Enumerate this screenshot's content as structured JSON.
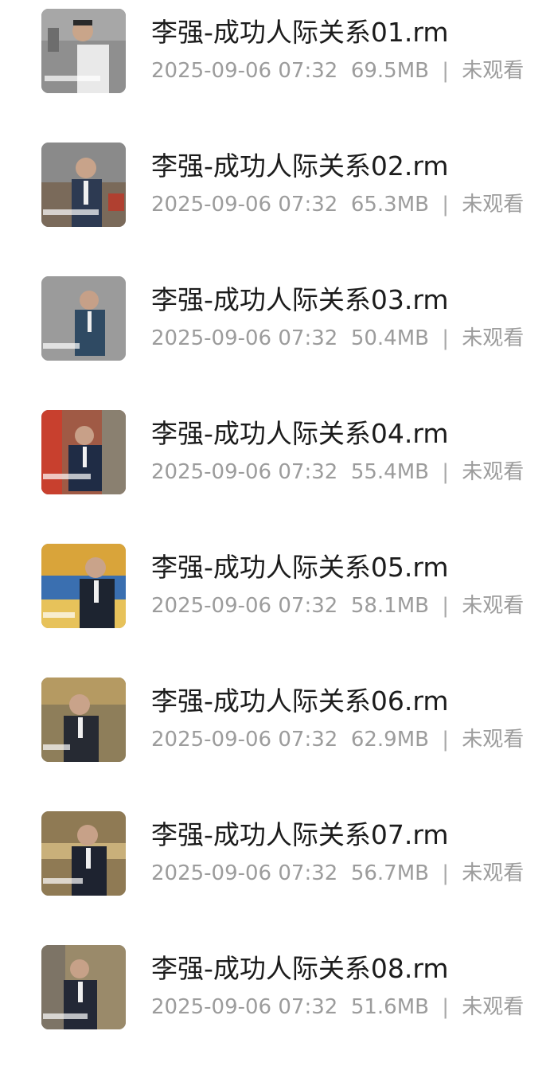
{
  "files": [
    {
      "name": "李强-成功人际关系01.rm",
      "date": "2025-09-06 07:32",
      "size": "69.5MB",
      "status": "未观看",
      "thumb_bg": "#8f8f8f",
      "thumb_accent": "#e9e9e9"
    },
    {
      "name": "李强-成功人际关系02.rm",
      "date": "2025-09-06 07:32",
      "size": "65.3MB",
      "status": "未观看",
      "thumb_bg": "#8a8a8a",
      "thumb_accent": "#2d3a52"
    },
    {
      "name": "李强-成功人际关系03.rm",
      "date": "2025-09-06 07:32",
      "size": "50.4MB",
      "status": "未观看",
      "thumb_bg": "#9b9b9b",
      "thumb_accent": "#2f4a63"
    },
    {
      "name": "李强-成功人际关系04.rm",
      "date": "2025-09-06 07:32",
      "size": "55.4MB",
      "status": "未观看",
      "thumb_bg": "#a05a45",
      "thumb_accent": "#1f2c45"
    },
    {
      "name": "李强-成功人际关系05.rm",
      "date": "2025-09-06 07:32",
      "size": "58.1MB",
      "status": "未观看",
      "thumb_bg": "#d9a43a",
      "thumb_accent": "#1d2430"
    },
    {
      "name": "李强-成功人际关系06.rm",
      "date": "2025-09-06 07:32",
      "size": "62.9MB",
      "status": "未观看",
      "thumb_bg": "#8e7e5a",
      "thumb_accent": "#262a33"
    },
    {
      "name": "李强-成功人际关系07.rm",
      "date": "2025-09-06 07:32",
      "size": "56.7MB",
      "status": "未观看",
      "thumb_bg": "#8f7a54",
      "thumb_accent": "#1e2330"
    },
    {
      "name": "李强-成功人际关系08.rm",
      "date": "2025-09-06 07:32",
      "size": "51.6MB",
      "status": "未观看",
      "thumb_bg": "#9a8a6a",
      "thumb_accent": "#232836"
    }
  ],
  "separator": "|",
  "icons": {
    "thumbnail": "video-thumbnail-icon"
  }
}
